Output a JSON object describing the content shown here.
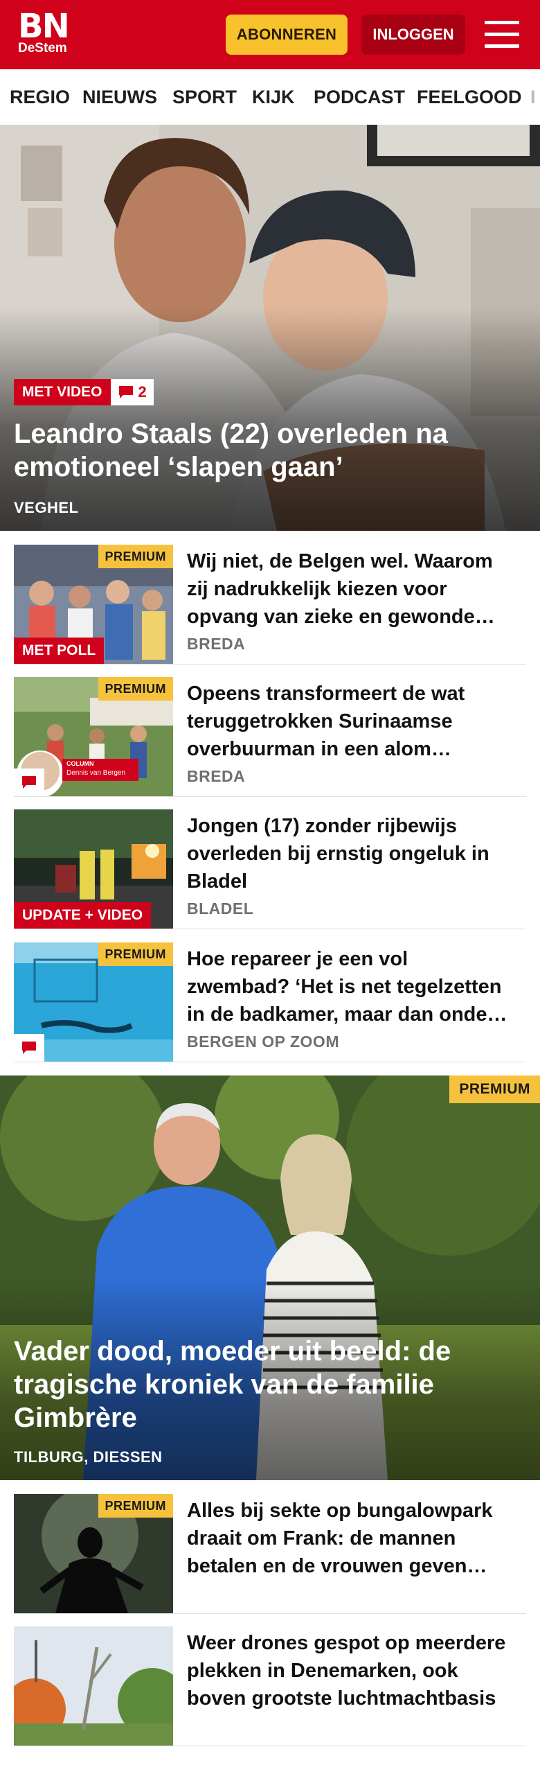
{
  "header": {
    "logo_main": "BN",
    "logo_sub": "DeStem",
    "subscribe_label": "ABONNEREN",
    "login_label": "INLOGGEN"
  },
  "nav": {
    "items": [
      "REGIO",
      "NIEUWS",
      "SPORT",
      "KIJK",
      "PODCAST",
      "FEELGOOD",
      "I"
    ]
  },
  "hero": {
    "badge": "MET VIDEO",
    "comment_count": "2",
    "title": "Leandro Staals (22) overleden na emotioneel ‘slapen gaan’",
    "location": "VEGHEL"
  },
  "articles": [
    {
      "premium": "PREMIUM",
      "badge": "MET POLL",
      "title": "Wij niet, de Belgen wel. Waarom zij nadrukkelijk kiezen voor opvang van zieke en gewonde…",
      "location": "BREDA"
    },
    {
      "premium": "PREMIUM",
      "column_label": "COLUMN",
      "column_author": "Dennis van Bergen",
      "title": "Opeens transformeert de wat teruggetrokken Surinaamse overbuurman in een alom…",
      "location": "BREDA"
    },
    {
      "badge": "UPDATE + VIDEO",
      "title": "Jongen (17) zonder rijbewijs overleden bij ernstig ongeluk in Bladel",
      "location": "BLADEL"
    },
    {
      "premium": "PREMIUM",
      "title": "Hoe repareer je een vol zwembad? ‘Het is net tegelzetten in de badkamer, maar dan onde…",
      "location": "BERGEN OP ZOOM"
    }
  ],
  "feature": {
    "premium": "PREMIUM",
    "title": "Vader dood, moeder uit beeld: de tragische kroniek van de familie Gimbrère",
    "location": "TILBURG, DIESSEN"
  },
  "articles_bottom": [
    {
      "premium": "PREMIUM",
      "title": "Alles bij sekte op bungalowpark draait om Frank: de mannen betalen en de vrouwen geven…"
    },
    {
      "title": "Weer drones gespot op meerdere plekken in Denemarken, ook boven grootste luchtmachtbasis"
    }
  ]
}
